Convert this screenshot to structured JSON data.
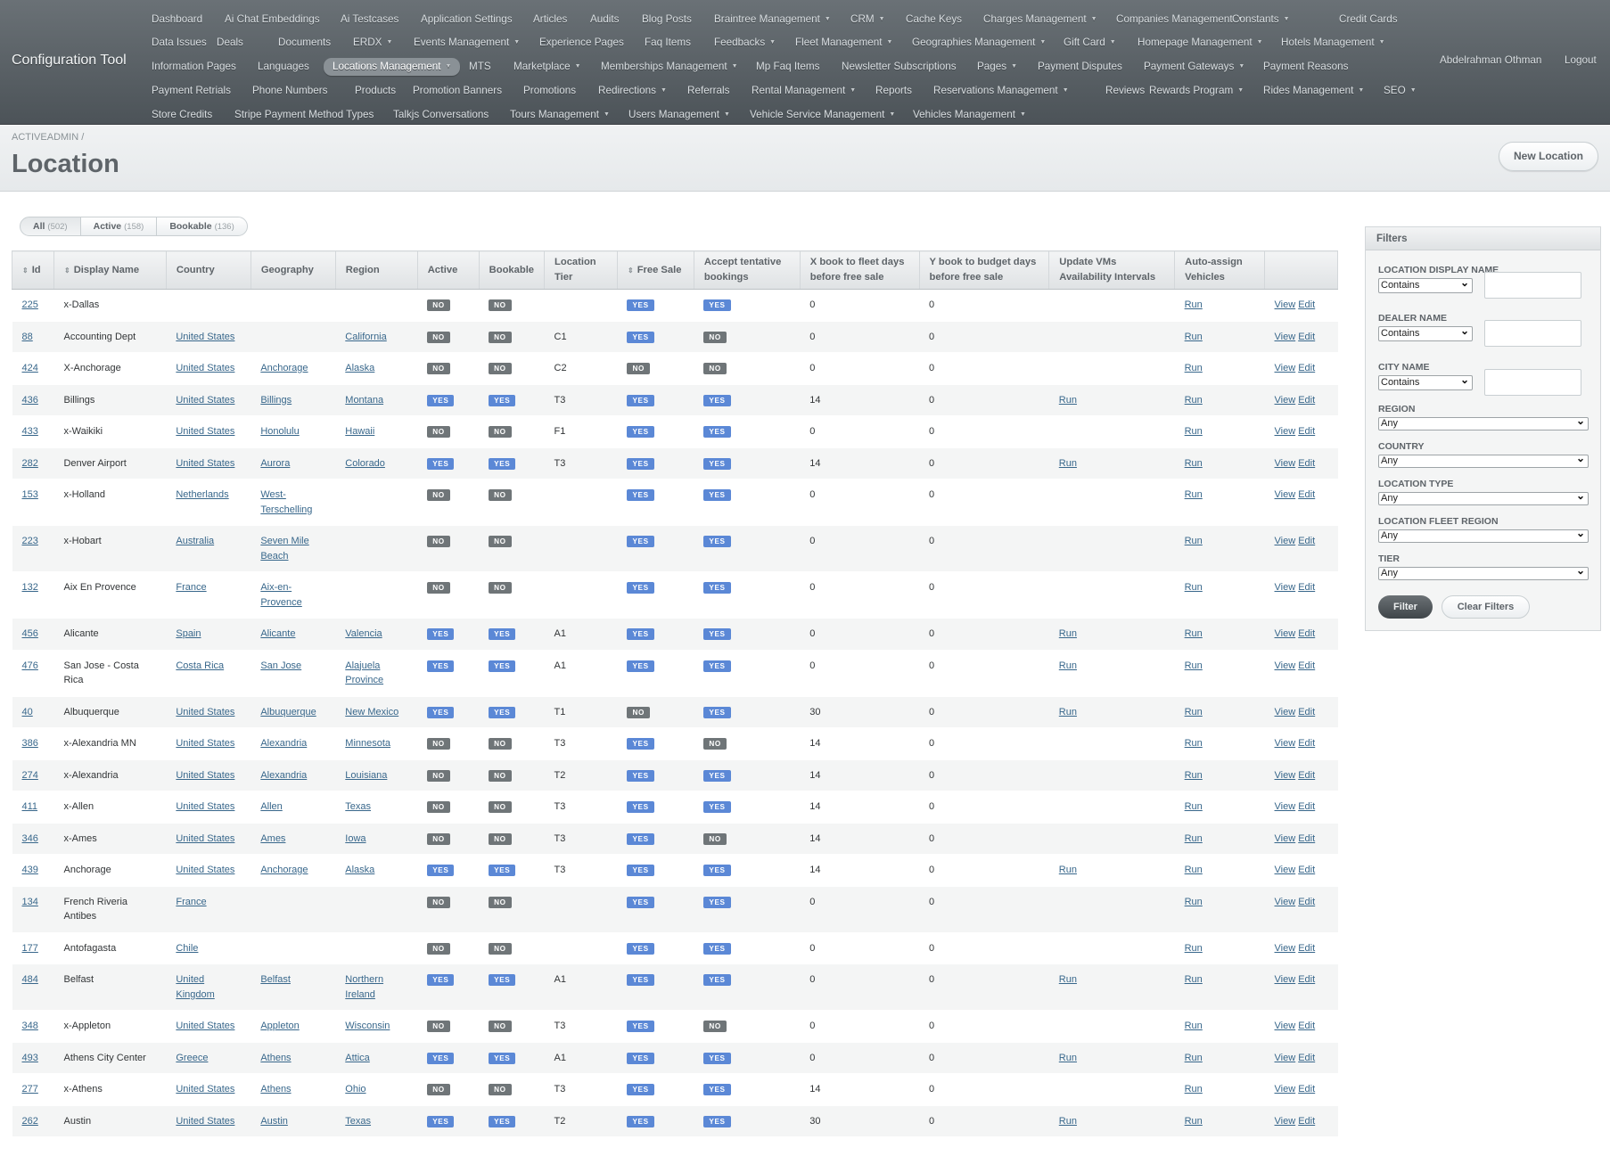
{
  "header": {
    "site_title": "Configuration Tool",
    "user_name": "Abdelrahman Othman",
    "logout": "Logout"
  },
  "nav": [
    [
      {
        "label": "Dashboard"
      },
      {
        "label": "Ai Chat Embeddings"
      },
      {
        "label": "Ai Testcases"
      },
      {
        "label": "Application Settings"
      },
      {
        "label": "Articles"
      },
      {
        "label": "Audits"
      },
      {
        "label": "Blog Posts"
      },
      {
        "label": "Braintree Management",
        "dropdown": true
      },
      {
        "label": "CRM",
        "dropdown": true
      },
      {
        "label": "Cache Keys"
      },
      {
        "label": "Charges Management",
        "dropdown": true
      },
      {
        "label": "Companies Management",
        "dropdown": true
      },
      {
        "label": "Constants",
        "dropdown": true
      },
      {
        "label": "Credit Cards"
      }
    ],
    [
      {
        "label": "Data Issues"
      },
      {
        "label": "Deals"
      },
      {
        "label": "Documents"
      },
      {
        "label": "ERDX",
        "dropdown": true
      },
      {
        "label": "Events Management",
        "dropdown": true
      },
      {
        "label": "Experience Pages"
      },
      {
        "label": "Faq Items"
      },
      {
        "label": "Feedbacks",
        "dropdown": true
      },
      {
        "label": "Fleet Management",
        "dropdown": true
      },
      {
        "label": "Geographies Management",
        "dropdown": true
      },
      {
        "label": "Gift Card",
        "dropdown": true
      },
      {
        "label": "Homepage Management",
        "dropdown": true
      },
      {
        "label": "Hotels Management",
        "dropdown": true
      }
    ],
    [
      {
        "label": "Information Pages"
      },
      {
        "label": "Languages"
      },
      {
        "label": "Locations Management",
        "dropdown": true,
        "current": true
      },
      {
        "label": "MTS"
      },
      {
        "label": "Marketplace",
        "dropdown": true
      },
      {
        "label": "Memberships Management",
        "dropdown": true
      },
      {
        "label": "Mp Faq Items"
      },
      {
        "label": "Newsletter Subscriptions"
      },
      {
        "label": "Pages",
        "dropdown": true
      },
      {
        "label": "Payment Disputes"
      },
      {
        "label": "Payment Gateways",
        "dropdown": true
      },
      {
        "label": "Payment Reasons"
      }
    ],
    [
      {
        "label": "Payment Retrials"
      },
      {
        "label": "Phone Numbers"
      },
      {
        "label": "Products"
      },
      {
        "label": "Promotion Banners"
      },
      {
        "label": "Promotions"
      },
      {
        "label": "Redirections",
        "dropdown": true
      },
      {
        "label": "Referrals"
      },
      {
        "label": "Rental Management",
        "dropdown": true
      },
      {
        "label": "Reports"
      },
      {
        "label": "Reservations Management",
        "dropdown": true
      },
      {
        "label": "Reviews"
      },
      {
        "label": "Rewards Program",
        "dropdown": true
      },
      {
        "label": "Rides Management",
        "dropdown": true
      },
      {
        "label": "SEO",
        "dropdown": true
      }
    ],
    [
      {
        "label": "Store Credits"
      },
      {
        "label": "Stripe Payment Method Types"
      },
      {
        "label": "Talkjs Conversations"
      },
      {
        "label": "Tours Management",
        "dropdown": true
      },
      {
        "label": "Users Management",
        "dropdown": true
      },
      {
        "label": "Vehicle Service Management",
        "dropdown": true
      },
      {
        "label": "Vehicles Management",
        "dropdown": true
      }
    ]
  ],
  "breadcrumb": "ACTIVEADMIN",
  "breadcrumb_sep": "/",
  "page_title": "Location",
  "new_button": "New Location",
  "scopes": [
    {
      "label": "All",
      "count": "(502)",
      "selected": true
    },
    {
      "label": "Active",
      "count": "(158)"
    },
    {
      "label": "Bookable",
      "count": "(136)"
    }
  ],
  "columns": [
    {
      "label": "Id",
      "sortable": true
    },
    {
      "label": "Display Name",
      "sortable": true
    },
    {
      "label": "Country"
    },
    {
      "label": "Geography"
    },
    {
      "label": "Region"
    },
    {
      "label": "Active"
    },
    {
      "label": "Bookable"
    },
    {
      "label": "Location Tier"
    },
    {
      "label": "Free Sale",
      "sortable": true
    },
    {
      "label": "Accept tentative bookings"
    },
    {
      "label": "X book to fleet days before free sale"
    },
    {
      "label": "Y book to budget days before free sale"
    },
    {
      "label": "Update VMs Availability Intervals"
    },
    {
      "label": "Auto-assign Vehicles"
    },
    {
      "label": ""
    }
  ],
  "rows": [
    {
      "id": "225",
      "name": "x-Dallas",
      "country": "",
      "geo": "",
      "region": "",
      "active": "NO",
      "bookable": "NO",
      "tier": "",
      "free": "YES",
      "tentative": "YES",
      "x": "0",
      "y": "0",
      "vms": "",
      "auto": "Run"
    },
    {
      "id": "88",
      "name": "Accounting Dept",
      "country": "United States",
      "geo": "",
      "region": "California",
      "active": "NO",
      "bookable": "NO",
      "tier": "C1",
      "free": "YES",
      "tentative": "NO",
      "x": "0",
      "y": "0",
      "vms": "",
      "auto": "Run"
    },
    {
      "id": "424",
      "name": "X-Anchorage",
      "country": "United States",
      "geo": "Anchorage",
      "region": "Alaska",
      "active": "NO",
      "bookable": "NO",
      "tier": "C2",
      "free": "NO",
      "tentative": "NO",
      "x": "0",
      "y": "0",
      "vms": "",
      "auto": "Run"
    },
    {
      "id": "436",
      "name": "Billings",
      "country": "United States",
      "geo": "Billings",
      "region": "Montana",
      "active": "YES",
      "bookable": "YES",
      "tier": "T3",
      "free": "YES",
      "tentative": "YES",
      "x": "14",
      "y": "0",
      "vms": "Run",
      "auto": "Run"
    },
    {
      "id": "433",
      "name": "x-Waikiki",
      "country": "United States",
      "geo": "Honolulu",
      "region": "Hawaii",
      "active": "NO",
      "bookable": "NO",
      "tier": "F1",
      "free": "YES",
      "tentative": "YES",
      "x": "0",
      "y": "0",
      "vms": "",
      "auto": "Run"
    },
    {
      "id": "282",
      "name": "Denver Airport",
      "country": "United States",
      "geo": "Aurora",
      "region": "Colorado",
      "active": "YES",
      "bookable": "YES",
      "tier": "T3",
      "free": "YES",
      "tentative": "YES",
      "x": "14",
      "y": "0",
      "vms": "Run",
      "auto": "Run"
    },
    {
      "id": "153",
      "name": "x-Holland",
      "country": "Netherlands",
      "geo": "West-Terschelling",
      "region": "",
      "active": "NO",
      "bookable": "NO",
      "tier": "",
      "free": "YES",
      "tentative": "YES",
      "x": "0",
      "y": "0",
      "vms": "",
      "auto": "Run"
    },
    {
      "id": "223",
      "name": "x-Hobart",
      "country": "Australia",
      "geo": "Seven Mile Beach",
      "region": "",
      "active": "NO",
      "bookable": "NO",
      "tier": "",
      "free": "YES",
      "tentative": "YES",
      "x": "0",
      "y": "0",
      "vms": "",
      "auto": "Run"
    },
    {
      "id": "132",
      "name": "Aix En Provence",
      "country": "France",
      "geo": "Aix-en-Provence",
      "region": "",
      "active": "NO",
      "bookable": "NO",
      "tier": "",
      "free": "YES",
      "tentative": "YES",
      "x": "0",
      "y": "0",
      "vms": "",
      "auto": "Run"
    },
    {
      "id": "456",
      "name": "Alicante",
      "country": "Spain",
      "geo": "Alicante",
      "region": "Valencia",
      "active": "YES",
      "bookable": "YES",
      "tier": "A1",
      "free": "YES",
      "tentative": "YES",
      "x": "0",
      "y": "0",
      "vms": "Run",
      "auto": "Run"
    },
    {
      "id": "476",
      "name": "San Jose - Costa Rica",
      "country": "Costa Rica",
      "geo": "San Jose",
      "region": "Alajuela Province",
      "active": "YES",
      "bookable": "YES",
      "tier": "A1",
      "free": "YES",
      "tentative": "YES",
      "x": "0",
      "y": "0",
      "vms": "Run",
      "auto": "Run"
    },
    {
      "id": "40",
      "name": "Albuquerque",
      "country": "United States",
      "geo": "Albuquerque",
      "region": "New Mexico",
      "active": "YES",
      "bookable": "YES",
      "tier": "T1",
      "free": "NO",
      "tentative": "YES",
      "x": "30",
      "y": "0",
      "vms": "Run",
      "auto": "Run"
    },
    {
      "id": "386",
      "name": "x-Alexandria MN",
      "country": "United States",
      "geo": "Alexandria",
      "region": "Minnesota",
      "active": "NO",
      "bookable": "NO",
      "tier": "T3",
      "free": "YES",
      "tentative": "NO",
      "x": "14",
      "y": "0",
      "vms": "",
      "auto": "Run"
    },
    {
      "id": "274",
      "name": "x-Alexandria",
      "country": "United States",
      "geo": "Alexandria",
      "region": "Louisiana",
      "active": "NO",
      "bookable": "NO",
      "tier": "T2",
      "free": "YES",
      "tentative": "YES",
      "x": "14",
      "y": "0",
      "vms": "",
      "auto": "Run"
    },
    {
      "id": "411",
      "name": "x-Allen",
      "country": "United States",
      "geo": "Allen",
      "region": "Texas",
      "active": "NO",
      "bookable": "NO",
      "tier": "T3",
      "free": "YES",
      "tentative": "YES",
      "x": "14",
      "y": "0",
      "vms": "",
      "auto": "Run"
    },
    {
      "id": "346",
      "name": "x-Ames",
      "country": "United States",
      "geo": "Ames",
      "region": "Iowa",
      "active": "NO",
      "bookable": "NO",
      "tier": "T3",
      "free": "YES",
      "tentative": "NO",
      "x": "14",
      "y": "0",
      "vms": "",
      "auto": "Run"
    },
    {
      "id": "439",
      "name": "Anchorage",
      "country": "United States",
      "geo": "Anchorage",
      "region": "Alaska",
      "active": "YES",
      "bookable": "YES",
      "tier": "T3",
      "free": "YES",
      "tentative": "YES",
      "x": "14",
      "y": "0",
      "vms": "Run",
      "auto": "Run"
    },
    {
      "id": "134",
      "name": "French Riveria Antibes",
      "country": "France",
      "geo": "",
      "region": "",
      "active": "NO",
      "bookable": "NO",
      "tier": "",
      "free": "YES",
      "tentative": "YES",
      "x": "0",
      "y": "0",
      "vms": "",
      "auto": "Run"
    },
    {
      "id": "177",
      "name": "Antofagasta",
      "country": "Chile",
      "geo": "",
      "region": "",
      "active": "NO",
      "bookable": "NO",
      "tier": "",
      "free": "YES",
      "tentative": "YES",
      "x": "0",
      "y": "0",
      "vms": "",
      "auto": "Run"
    },
    {
      "id": "484",
      "name": "Belfast",
      "country": "United Kingdom",
      "geo": "Belfast",
      "region": "Northern Ireland",
      "active": "YES",
      "bookable": "YES",
      "tier": "A1",
      "free": "YES",
      "tentative": "YES",
      "x": "0",
      "y": "0",
      "vms": "Run",
      "auto": "Run"
    },
    {
      "id": "348",
      "name": "x-Appleton",
      "country": "United States",
      "geo": "Appleton",
      "region": "Wisconsin",
      "active": "NO",
      "bookable": "NO",
      "tier": "T3",
      "free": "YES",
      "tentative": "NO",
      "x": "0",
      "y": "0",
      "vms": "",
      "auto": "Run"
    },
    {
      "id": "493",
      "name": "Athens City Center",
      "country": "Greece",
      "geo": "Athens",
      "region": "Attica",
      "active": "YES",
      "bookable": "YES",
      "tier": "A1",
      "free": "YES",
      "tentative": "YES",
      "x": "0",
      "y": "0",
      "vms": "Run",
      "auto": "Run"
    },
    {
      "id": "277",
      "name": "x-Athens",
      "country": "United States",
      "geo": "Athens",
      "region": "Ohio",
      "active": "NO",
      "bookable": "NO",
      "tier": "T3",
      "free": "YES",
      "tentative": "YES",
      "x": "14",
      "y": "0",
      "vms": "",
      "auto": "Run"
    },
    {
      "id": "262",
      "name": "Austin",
      "country": "United States",
      "geo": "Austin",
      "region": "Texas",
      "active": "YES",
      "bookable": "YES",
      "tier": "T2",
      "free": "YES",
      "tentative": "YES",
      "x": "30",
      "y": "0",
      "vms": "Run",
      "auto": "Run"
    }
  ],
  "row_actions": {
    "view": "View",
    "edit": "Edit"
  },
  "filters": {
    "title": "Filters",
    "display_name_label": "Location Display Name",
    "dealer_name_label": "Dealer Name",
    "city_name_label": "City Name",
    "contains": "Contains",
    "region_label": "Region",
    "country_label": "Country",
    "location_type_label": "Location Type",
    "fleet_region_label": "Location Fleet Region",
    "tier_label": "Tier",
    "any": "Any",
    "filter_button": "Filter",
    "clear_button": "Clear Filters"
  },
  "colors": {
    "yes_tag": "#5b88d6",
    "no_tag": "#6f7578",
    "link": "#38678b",
    "header_bg": "#5a6166"
  }
}
